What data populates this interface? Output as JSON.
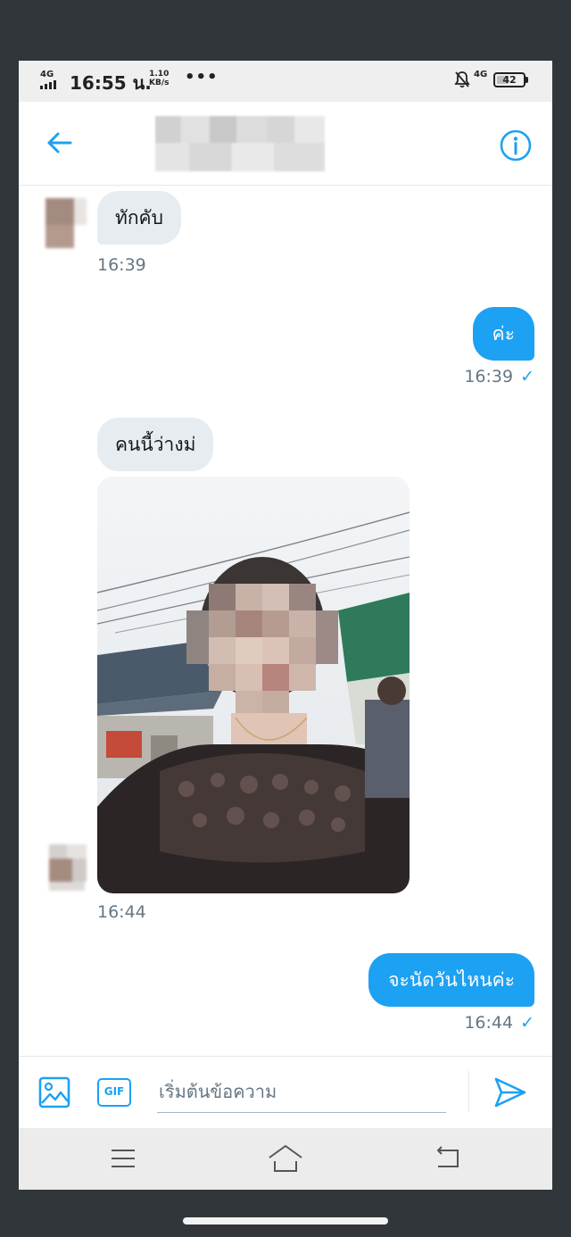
{
  "status_bar": {
    "network_left": "4G",
    "time": "16:55 น.",
    "speed_value": "1.10",
    "speed_unit": "KB/s",
    "more": "•••",
    "network_right": "4G",
    "battery": "42"
  },
  "header": {
    "back_icon": "arrow-left-icon",
    "info_icon": "info-circle-icon"
  },
  "messages": [
    {
      "direction": "in",
      "text": "ทักคับ",
      "time": "16:39"
    },
    {
      "direction": "out",
      "text": "ค่ะ",
      "time": "16:39",
      "status_icon": "✓"
    },
    {
      "direction": "in",
      "text": "คนนี้ว่างม่",
      "time": ""
    },
    {
      "direction": "in",
      "type": "photo",
      "time": "16:44"
    },
    {
      "direction": "out",
      "text": "จะนัดวันไหนค่ะ",
      "time": "16:44",
      "status_icon": "✓"
    }
  ],
  "composer": {
    "placeholder": "เริ่มต้นข้อความ",
    "gif_label": "GIF",
    "media_icon": "image-icon",
    "send_icon": "send-icon"
  },
  "colors": {
    "accent": "#1da1f2",
    "incoming_bubble": "#e6ecf0",
    "timestamp": "#657786"
  }
}
